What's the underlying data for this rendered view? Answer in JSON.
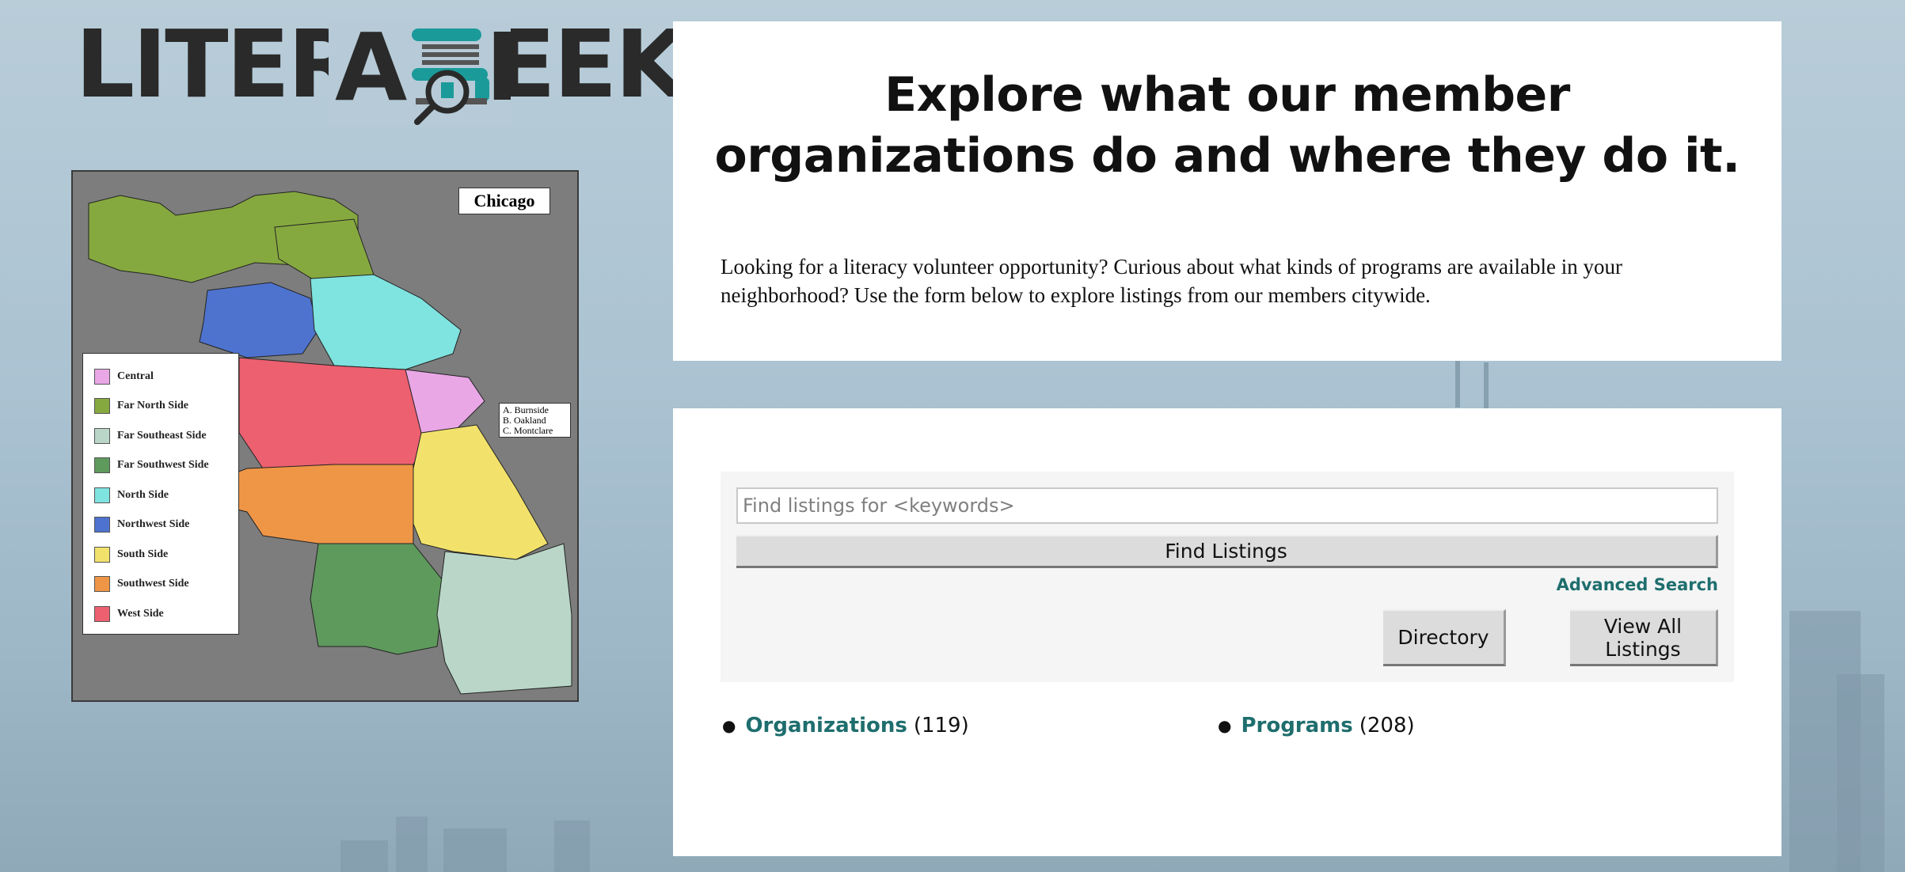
{
  "logo": {
    "text": "LITERASEEK",
    "accent_color": "#1b9a9a"
  },
  "map": {
    "title": "Chicago",
    "legend": [
      {
        "label": "Central",
        "color": "#e9a7e6"
      },
      {
        "label": "Far North Side",
        "color": "#86a93f"
      },
      {
        "label": "Far Southeast Side",
        "color": "#b9d6c8"
      },
      {
        "label": "Far Southwest Side",
        "color": "#5e9a5c"
      },
      {
        "label": "North Side",
        "color": "#7fe3df"
      },
      {
        "label": "Northwest Side",
        "color": "#4e73cf"
      },
      {
        "label": "South Side",
        "color": "#f2e26b"
      },
      {
        "label": "Southwest Side",
        "color": "#ef9646"
      },
      {
        "label": "West Side",
        "color": "#ec6070"
      }
    ],
    "note": [
      "A. Burnside",
      "B. Oakland",
      "C. Montclare"
    ]
  },
  "intro": {
    "headline": "Explore what our member organizations do and where they do it.",
    "body": "Looking for a literacy volunteer opportunity? Curious about what kinds of programs are available in your neighborhood? Use the form below to explore listings from our members citywide."
  },
  "search": {
    "placeholder": "Find listings for <keywords>",
    "find_label": "Find Listings",
    "advanced_label": "Advanced Search",
    "directory_label": "Directory",
    "view_all_label": "View All Listings"
  },
  "counts": {
    "organizations_label": "Organizations",
    "organizations_count": "(119)",
    "programs_label": "Programs",
    "programs_count": "(208)"
  }
}
